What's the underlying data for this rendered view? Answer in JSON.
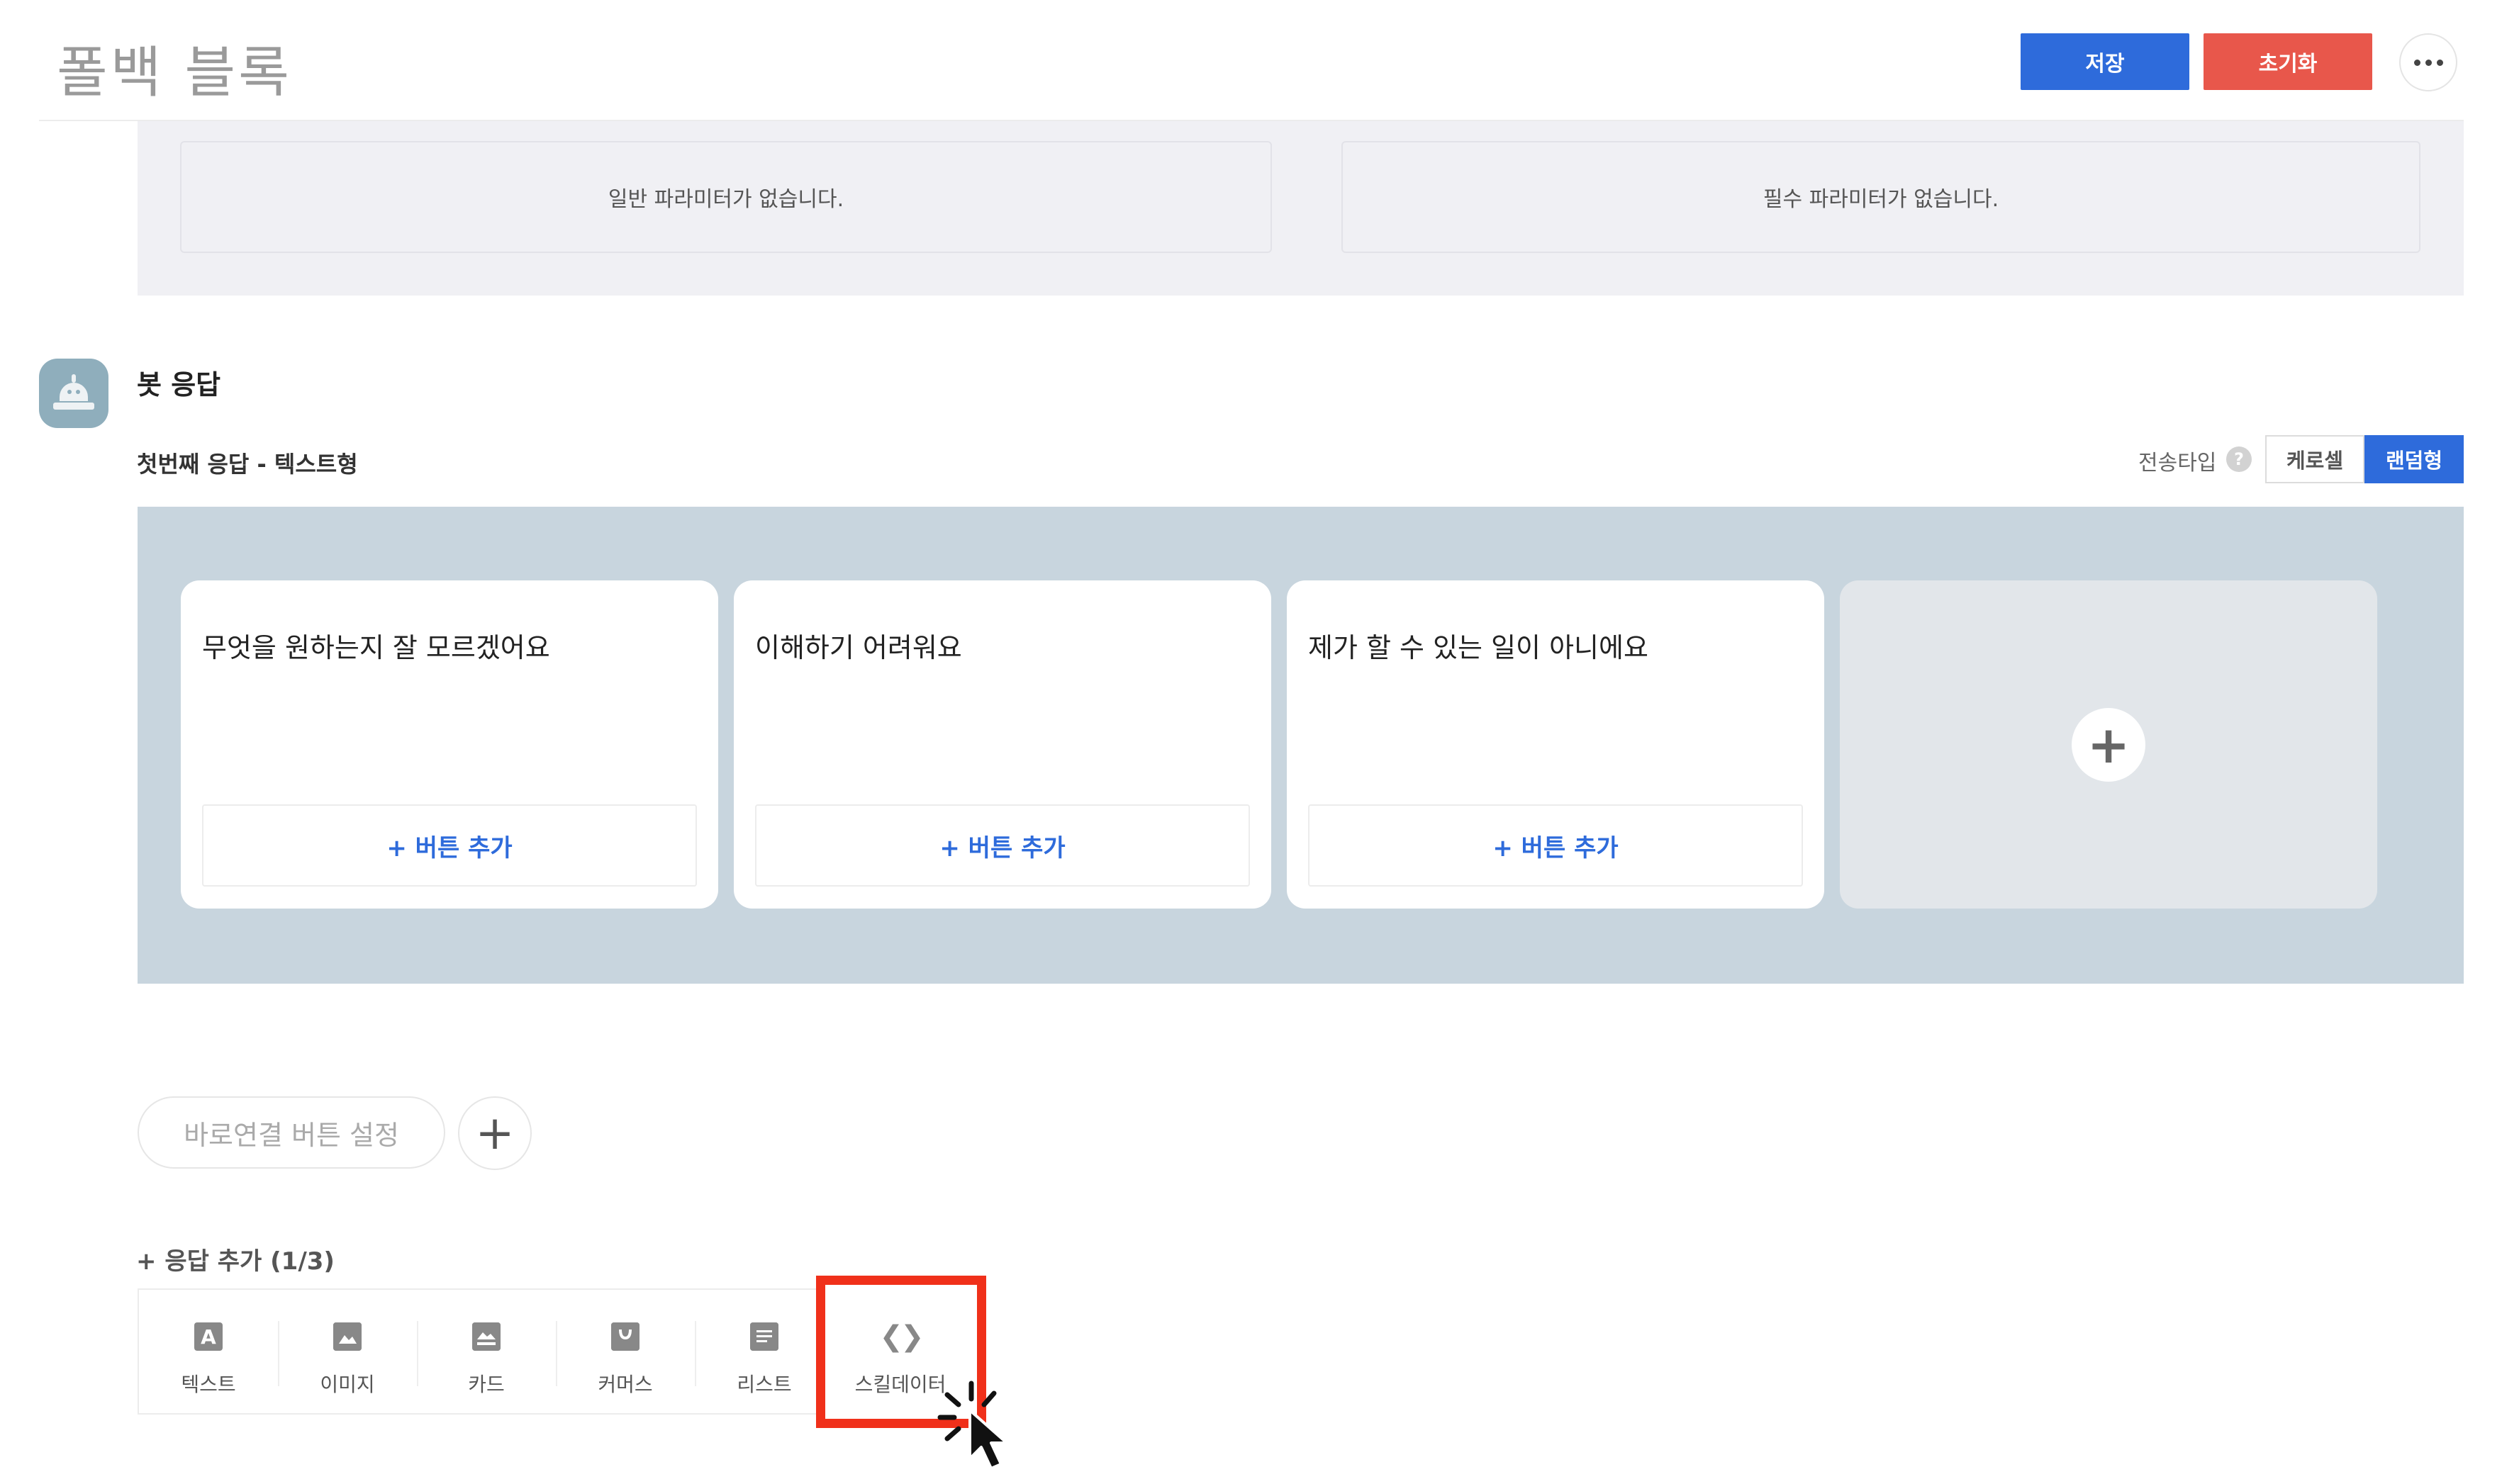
{
  "header": {
    "title": "폴백 블록",
    "save_label": "저장",
    "reset_label": "초기화",
    "save_color": "#2e6bdb",
    "reset_color": "#e8574b"
  },
  "parameters": {
    "general_empty": "일반 파라미터가 없습니다.",
    "required_empty": "필수 파라미터가 없습니다."
  },
  "bot_response": {
    "title": "봇 응답",
    "subtitle": "첫번째 응답 - 텍스트형",
    "send_type_label": "전송타입",
    "help_icon_text": "?",
    "toggle_options": [
      "케로셀",
      "랜덤형"
    ],
    "selected_toggle": "랜덤형",
    "cards": [
      {
        "text": "무엇을 원하는지 잘 모르겠어요",
        "button_label": "+ 버튼 추가"
      },
      {
        "text": "이해하기 어려워요",
        "button_label": "+ 버튼 추가"
      },
      {
        "text": "제가 할 수 있는 일이 아니에요",
        "button_label": "+ 버튼 추가"
      }
    ],
    "add_card_icon": "+"
  },
  "quick_reply": {
    "label": "바로연결 버튼 설정",
    "add_icon": "+"
  },
  "add_response": {
    "label": "+ 응답 추가 (1/3)",
    "types": [
      {
        "label": "텍스트",
        "icon": "text-icon",
        "glyph": "A"
      },
      {
        "label": "이미지",
        "icon": "image-icon",
        "glyph": ""
      },
      {
        "label": "카드",
        "icon": "card-icon",
        "glyph": ""
      },
      {
        "label": "커머스",
        "icon": "commerce-icon",
        "glyph": ""
      },
      {
        "label": "리스트",
        "icon": "list-icon",
        "glyph": ""
      },
      {
        "label": "스킬데이터",
        "icon": "code-icon",
        "glyph": "❮❯"
      }
    ],
    "highlight_color": "#f0301a"
  }
}
